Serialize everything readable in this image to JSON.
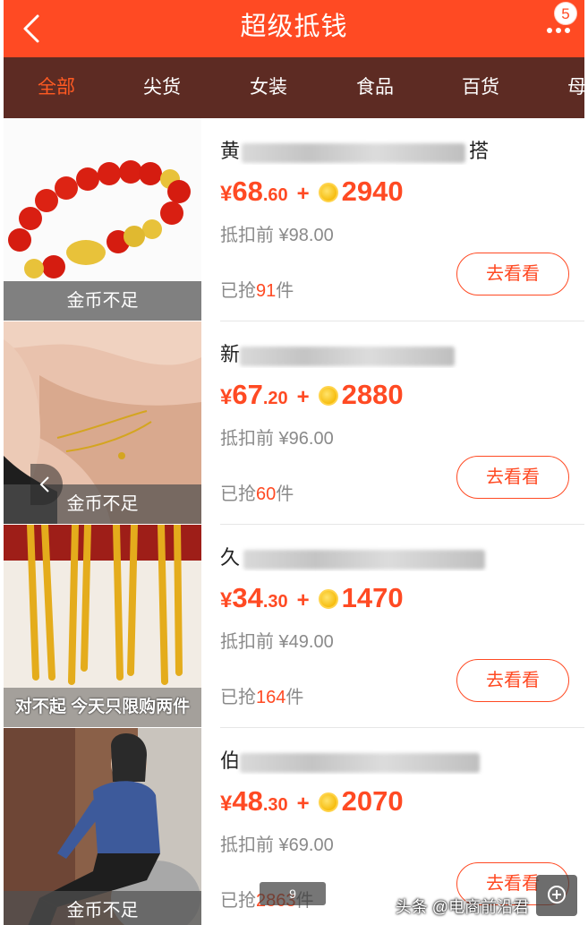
{
  "header": {
    "title": "超级抵钱",
    "badge_count": "5"
  },
  "categories": [
    {
      "label": "全部",
      "active": true
    },
    {
      "label": "尖货",
      "active": false
    },
    {
      "label": "女装",
      "active": false
    },
    {
      "label": "食品",
      "active": false
    },
    {
      "label": "百货",
      "active": false
    },
    {
      "label": "母",
      "active": false
    }
  ],
  "items": [
    {
      "title_head": "黄",
      "title_tail": "搭",
      "thumb_label": "金币不足",
      "price_yen": "¥",
      "price_int": "68",
      "price_dec": ".60",
      "plus": "+",
      "coins": "2940",
      "orig_price": "抵扣前 ¥98.00",
      "sold_prefix": "已抢",
      "sold_count": "91",
      "sold_suffix": "件",
      "button": "去看看"
    },
    {
      "title_head": "新",
      "title_tail": "",
      "thumb_label": "金币不足",
      "price_yen": "¥",
      "price_int": "67",
      "price_dec": ".20",
      "plus": "+",
      "coins": "2880",
      "orig_price": "抵扣前 ¥96.00",
      "sold_prefix": "已抢",
      "sold_count": "60",
      "sold_suffix": "件",
      "button": "去看看"
    },
    {
      "title_head": "久",
      "title_tail": "",
      "thumb_label": "对不起 今天只限购两件",
      "price_yen": "¥",
      "price_int": "34",
      "price_dec": ".30",
      "plus": "+",
      "coins": "1470",
      "orig_price": "抵扣前 ¥49.00",
      "sold_prefix": "已抢",
      "sold_count": "164",
      "sold_suffix": "件",
      "button": "去看看"
    },
    {
      "title_head": "伯",
      "title_tail": "",
      "thumb_label": "金币不足",
      "price_yen": "¥",
      "price_int": "48",
      "price_dec": ".30",
      "plus": "+",
      "coins": "2070",
      "orig_price": "抵扣前 ¥69.00",
      "sold_prefix": "已抢",
      "sold_count": "2863",
      "sold_suffix": "件",
      "button": "去看看"
    }
  ],
  "overlay": {
    "scroll_indicator": "9",
    "watermark": "头条 @电商前沿君"
  },
  "colors": {
    "accent": "#ff4a23",
    "category_bar": "#5d2b23",
    "coin": "#f6bd0f"
  },
  "icons": [
    "back-arrow-icon",
    "more-dots-icon",
    "coin-icon",
    "zoom-icon",
    "left-arrow-icon"
  ]
}
